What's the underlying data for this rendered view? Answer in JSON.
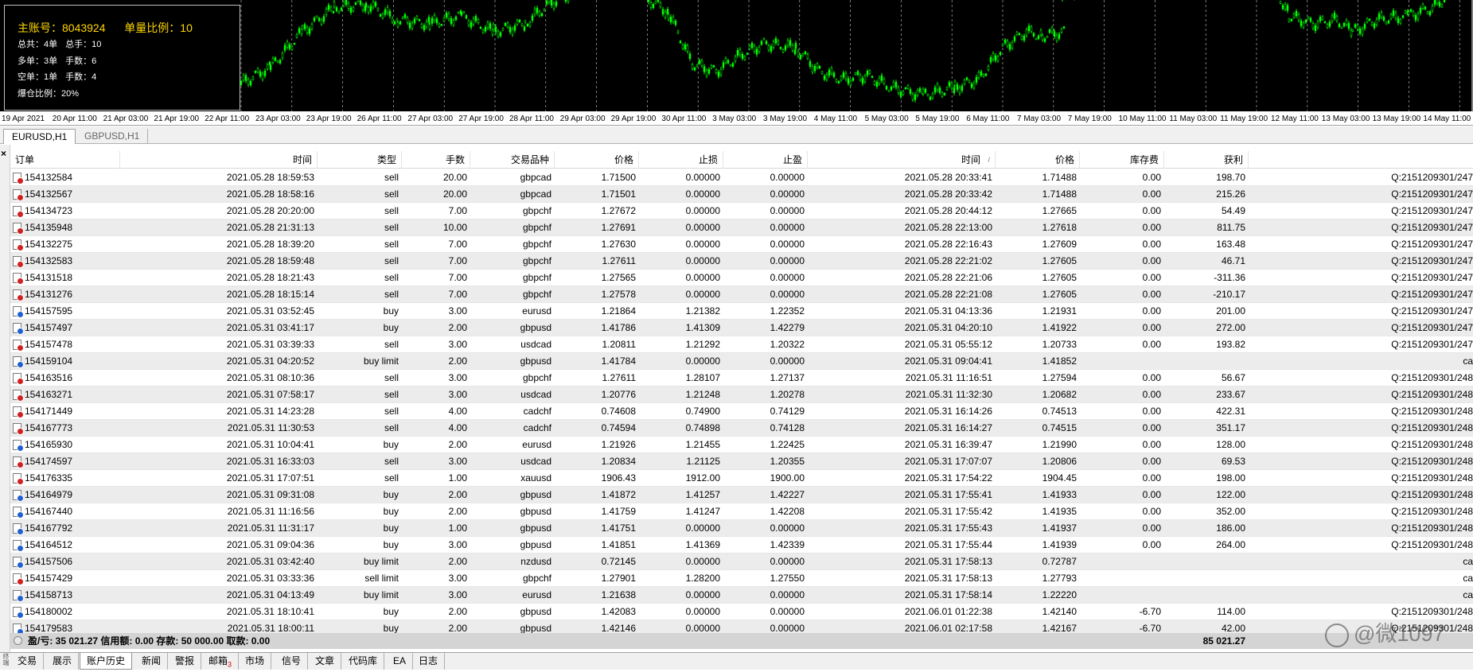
{
  "info_panel": {
    "account_label": "主账号：",
    "account": "8043924",
    "ratio_label": "单量比例：",
    "ratio": "10",
    "total_orders": "总共：4单",
    "total_lots": "总手：10",
    "buy_orders": "多单：3单",
    "buy_lots": "手数：6",
    "sell_orders": "空单：1单",
    "sell_lots": "手数：4",
    "margin_ratio": "爆仓比例：20%"
  },
  "time_axis": [
    "19 Apr 2021",
    "20 Apr 11:00",
    "21 Apr 03:00",
    "21 Apr 19:00",
    "22 Apr 11:00",
    "23 Apr 03:00",
    "23 Apr 19:00",
    "26 Apr 11:00",
    "27 Apr 03:00",
    "27 Apr 19:00",
    "28 Apr 11:00",
    "29 Apr 03:00",
    "29 Apr 19:00",
    "30 Apr 11:00",
    "3 May 03:00",
    "3 May 19:00",
    "4 May 11:00",
    "5 May 03:00",
    "5 May 19:00",
    "6 May 11:00",
    "7 May 03:00",
    "7 May 19:00",
    "10 May 11:00",
    "11 May 03:00",
    "11 May 19:00",
    "12 May 11:00",
    "13 May 03:00",
    "13 May 19:00",
    "14 May 11:00"
  ],
  "chart_tabs": [
    "EURUSD,H1",
    "GBPUSD,H1"
  ],
  "columns": {
    "order": "订单",
    "open_time": "时间",
    "type": "类型",
    "lots": "手数",
    "symbol": "交易品种",
    "open_price": "价格",
    "sl": "止损",
    "tp": "止盈",
    "close_time": "时间",
    "sort_mark": "/",
    "close_price": "价格",
    "swap": "库存费",
    "profit": "获利"
  },
  "rows": [
    {
      "order": "154132584",
      "open_time": "2021.05.28 18:59:53",
      "type": "sell",
      "lots": "20.00",
      "symbol": "gbpcad",
      "open_price": "1.71500",
      "sl": "0.00000",
      "tp": "0.00000",
      "close_time": "2021.05.28 20:33:41",
      "close_price": "1.71488",
      "swap": "0.00",
      "profit": "198.70",
      "comment": "Q:2151209301/247"
    },
    {
      "order": "154132567",
      "open_time": "2021.05.28 18:58:16",
      "type": "sell",
      "lots": "20.00",
      "symbol": "gbpcad",
      "open_price": "1.71501",
      "sl": "0.00000",
      "tp": "0.00000",
      "close_time": "2021.05.28 20:33:42",
      "close_price": "1.71488",
      "swap": "0.00",
      "profit": "215.26",
      "comment": "Q:2151209301/247"
    },
    {
      "order": "154134723",
      "open_time": "2021.05.28 20:20:00",
      "type": "sell",
      "lots": "7.00",
      "symbol": "gbpchf",
      "open_price": "1.27672",
      "sl": "0.00000",
      "tp": "0.00000",
      "close_time": "2021.05.28 20:44:12",
      "close_price": "1.27665",
      "swap": "0.00",
      "profit": "54.49",
      "comment": "Q:2151209301/247"
    },
    {
      "order": "154135948",
      "open_time": "2021.05.28 21:31:13",
      "type": "sell",
      "lots": "10.00",
      "symbol": "gbpchf",
      "open_price": "1.27691",
      "sl": "0.00000",
      "tp": "0.00000",
      "close_time": "2021.05.28 22:13:00",
      "close_price": "1.27618",
      "swap": "0.00",
      "profit": "811.75",
      "comment": "Q:2151209301/247"
    },
    {
      "order": "154132275",
      "open_time": "2021.05.28 18:39:20",
      "type": "sell",
      "lots": "7.00",
      "symbol": "gbpchf",
      "open_price": "1.27630",
      "sl": "0.00000",
      "tp": "0.00000",
      "close_time": "2021.05.28 22:16:43",
      "close_price": "1.27609",
      "swap": "0.00",
      "profit": "163.48",
      "comment": "Q:2151209301/247"
    },
    {
      "order": "154132583",
      "open_time": "2021.05.28 18:59:48",
      "type": "sell",
      "lots": "7.00",
      "symbol": "gbpchf",
      "open_price": "1.27611",
      "sl": "0.00000",
      "tp": "0.00000",
      "close_time": "2021.05.28 22:21:02",
      "close_price": "1.27605",
      "swap": "0.00",
      "profit": "46.71",
      "comment": "Q:2151209301/247"
    },
    {
      "order": "154131518",
      "open_time": "2021.05.28 18:21:43",
      "type": "sell",
      "lots": "7.00",
      "symbol": "gbpchf",
      "open_price": "1.27565",
      "sl": "0.00000",
      "tp": "0.00000",
      "close_time": "2021.05.28 22:21:06",
      "close_price": "1.27605",
      "swap": "0.00",
      "profit": "-311.36",
      "comment": "Q:2151209301/247"
    },
    {
      "order": "154131276",
      "open_time": "2021.05.28 18:15:14",
      "type": "sell",
      "lots": "7.00",
      "symbol": "gbpchf",
      "open_price": "1.27578",
      "sl": "0.00000",
      "tp": "0.00000",
      "close_time": "2021.05.28 22:21:08",
      "close_price": "1.27605",
      "swap": "0.00",
      "profit": "-210.17",
      "comment": "Q:2151209301/247"
    },
    {
      "order": "154157595",
      "open_time": "2021.05.31 03:52:45",
      "type": "buy",
      "lots": "3.00",
      "symbol": "eurusd",
      "open_price": "1.21864",
      "sl": "1.21382",
      "tp": "1.22352",
      "close_time": "2021.05.31 04:13:36",
      "close_price": "1.21931",
      "swap": "0.00",
      "profit": "201.00",
      "comment": "Q:2151209301/247"
    },
    {
      "order": "154157497",
      "open_time": "2021.05.31 03:41:17",
      "type": "buy",
      "lots": "2.00",
      "symbol": "gbpusd",
      "open_price": "1.41786",
      "sl": "1.41309",
      "tp": "1.42279",
      "close_time": "2021.05.31 04:20:10",
      "close_price": "1.41922",
      "swap": "0.00",
      "profit": "272.00",
      "comment": "Q:2151209301/247"
    },
    {
      "order": "154157478",
      "open_time": "2021.05.31 03:39:33",
      "type": "sell",
      "lots": "3.00",
      "symbol": "usdcad",
      "open_price": "1.20811",
      "sl": "1.21292",
      "tp": "1.20322",
      "close_time": "2021.05.31 05:55:12",
      "close_price": "1.20733",
      "swap": "0.00",
      "profit": "193.82",
      "comment": "Q:2151209301/247"
    },
    {
      "order": "154159104",
      "open_time": "2021.05.31 04:20:52",
      "type": "buy limit",
      "lots": "2.00",
      "symbol": "gbpusd",
      "open_price": "1.41784",
      "sl": "0.00000",
      "tp": "0.00000",
      "close_time": "2021.05.31 09:04:41",
      "close_price": "1.41852",
      "swap": "",
      "profit": "",
      "comment": "ca"
    },
    {
      "order": "154163516",
      "open_time": "2021.05.31 08:10:36",
      "type": "sell",
      "lots": "3.00",
      "symbol": "gbpchf",
      "open_price": "1.27611",
      "sl": "1.28107",
      "tp": "1.27137",
      "close_time": "2021.05.31 11:16:51",
      "close_price": "1.27594",
      "swap": "0.00",
      "profit": "56.67",
      "comment": "Q:2151209301/248"
    },
    {
      "order": "154163271",
      "open_time": "2021.05.31 07:58:17",
      "type": "sell",
      "lots": "3.00",
      "symbol": "usdcad",
      "open_price": "1.20776",
      "sl": "1.21248",
      "tp": "1.20278",
      "close_time": "2021.05.31 11:32:30",
      "close_price": "1.20682",
      "swap": "0.00",
      "profit": "233.67",
      "comment": "Q:2151209301/248"
    },
    {
      "order": "154171449",
      "open_time": "2021.05.31 14:23:28",
      "type": "sell",
      "lots": "4.00",
      "symbol": "cadchf",
      "open_price": "0.74608",
      "sl": "0.74900",
      "tp": "0.74129",
      "close_time": "2021.05.31 16:14:26",
      "close_price": "0.74513",
      "swap": "0.00",
      "profit": "422.31",
      "comment": "Q:2151209301/248"
    },
    {
      "order": "154167773",
      "open_time": "2021.05.31 11:30:53",
      "type": "sell",
      "lots": "4.00",
      "symbol": "cadchf",
      "open_price": "0.74594",
      "sl": "0.74898",
      "tp": "0.74128",
      "close_time": "2021.05.31 16:14:27",
      "close_price": "0.74515",
      "swap": "0.00",
      "profit": "351.17",
      "comment": "Q:2151209301/248"
    },
    {
      "order": "154165930",
      "open_time": "2021.05.31 10:04:41",
      "type": "buy",
      "lots": "2.00",
      "symbol": "eurusd",
      "open_price": "1.21926",
      "sl": "1.21455",
      "tp": "1.22425",
      "close_time": "2021.05.31 16:39:47",
      "close_price": "1.21990",
      "swap": "0.00",
      "profit": "128.00",
      "comment": "Q:2151209301/248"
    },
    {
      "order": "154174597",
      "open_time": "2021.05.31 16:33:03",
      "type": "sell",
      "lots": "3.00",
      "symbol": "usdcad",
      "open_price": "1.20834",
      "sl": "1.21125",
      "tp": "1.20355",
      "close_time": "2021.05.31 17:07:07",
      "close_price": "1.20806",
      "swap": "0.00",
      "profit": "69.53",
      "comment": "Q:2151209301/248"
    },
    {
      "order": "154176335",
      "open_time": "2021.05.31 17:07:51",
      "type": "sell",
      "lots": "1.00",
      "symbol": "xauusd",
      "open_price": "1906.43",
      "sl": "1912.00",
      "tp": "1900.00",
      "close_time": "2021.05.31 17:54:22",
      "close_price": "1904.45",
      "swap": "0.00",
      "profit": "198.00",
      "comment": "Q:2151209301/248"
    },
    {
      "order": "154164979",
      "open_time": "2021.05.31 09:31:08",
      "type": "buy",
      "lots": "2.00",
      "symbol": "gbpusd",
      "open_price": "1.41872",
      "sl": "1.41257",
      "tp": "1.42227",
      "close_time": "2021.05.31 17:55:41",
      "close_price": "1.41933",
      "swap": "0.00",
      "profit": "122.00",
      "comment": "Q:2151209301/248"
    },
    {
      "order": "154167440",
      "open_time": "2021.05.31 11:16:56",
      "type": "buy",
      "lots": "2.00",
      "symbol": "gbpusd",
      "open_price": "1.41759",
      "sl": "1.41247",
      "tp": "1.42208",
      "close_time": "2021.05.31 17:55:42",
      "close_price": "1.41935",
      "swap": "0.00",
      "profit": "352.00",
      "comment": "Q:2151209301/248"
    },
    {
      "order": "154167792",
      "open_time": "2021.05.31 11:31:17",
      "type": "buy",
      "lots": "1.00",
      "symbol": "gbpusd",
      "open_price": "1.41751",
      "sl": "0.00000",
      "tp": "0.00000",
      "close_time": "2021.05.31 17:55:43",
      "close_price": "1.41937",
      "swap": "0.00",
      "profit": "186.00",
      "comment": "Q:2151209301/248"
    },
    {
      "order": "154164512",
      "open_time": "2021.05.31 09:04:36",
      "type": "buy",
      "lots": "3.00",
      "symbol": "gbpusd",
      "open_price": "1.41851",
      "sl": "1.41369",
      "tp": "1.42339",
      "close_time": "2021.05.31 17:55:44",
      "close_price": "1.41939",
      "swap": "0.00",
      "profit": "264.00",
      "comment": "Q:2151209301/248"
    },
    {
      "order": "154157506",
      "open_time": "2021.05.31 03:42:40",
      "type": "buy limit",
      "lots": "2.00",
      "symbol": "nzdusd",
      "open_price": "0.72145",
      "sl": "0.00000",
      "tp": "0.00000",
      "close_time": "2021.05.31 17:58:13",
      "close_price": "0.72787",
      "swap": "",
      "profit": "",
      "comment": "ca"
    },
    {
      "order": "154157429",
      "open_time": "2021.05.31 03:33:36",
      "type": "sell limit",
      "lots": "3.00",
      "symbol": "gbpchf",
      "open_price": "1.27901",
      "sl": "1.28200",
      "tp": "1.27550",
      "close_time": "2021.05.31 17:58:13",
      "close_price": "1.27793",
      "swap": "",
      "profit": "",
      "comment": "ca"
    },
    {
      "order": "154158713",
      "open_time": "2021.05.31 04:13:49",
      "type": "buy limit",
      "lots": "3.00",
      "symbol": "eurusd",
      "open_price": "1.21638",
      "sl": "0.00000",
      "tp": "0.00000",
      "close_time": "2021.05.31 17:58:14",
      "close_price": "1.22220",
      "swap": "",
      "profit": "",
      "comment": "ca"
    },
    {
      "order": "154180002",
      "open_time": "2021.05.31 18:10:41",
      "type": "buy",
      "lots": "2.00",
      "symbol": "gbpusd",
      "open_price": "1.42083",
      "sl": "0.00000",
      "tp": "0.00000",
      "close_time": "2021.06.01 01:22:38",
      "close_price": "1.42140",
      "swap": "-6.70",
      "profit": "114.00",
      "comment": "Q:2151209301/248"
    },
    {
      "order": "154179583",
      "open_time": "2021.05.31 18:00:11",
      "type": "buy",
      "lots": "2.00",
      "symbol": "gbpusd",
      "open_price": "1.42146",
      "sl": "0.00000",
      "tp": "0.00000",
      "close_time": "2021.06.01 02:17:58",
      "close_price": "1.42167",
      "swap": "-6.70",
      "profit": "42.00",
      "comment": "Q:2151209301/248"
    }
  ],
  "summary": {
    "text": "盈/亏: 35 021.27  信用额: 0.00  存款: 50 000.00  取款: 0.00",
    "total_profit": "85 021.27"
  },
  "bottom_tabs": [
    {
      "label": "交易",
      "active": false,
      "badge": ""
    },
    {
      "label": "展示",
      "active": false,
      "badge": ""
    },
    {
      "label": "账户历史",
      "active": true,
      "badge": ""
    },
    {
      "label": "新闻",
      "active": false,
      "badge": ""
    },
    {
      "label": "警报",
      "active": false,
      "badge": ""
    },
    {
      "label": "邮箱",
      "active": false,
      "badge": "3"
    },
    {
      "label": "市场",
      "active": false,
      "badge": ""
    },
    {
      "label": "信号",
      "active": false,
      "badge": ""
    },
    {
      "label": "文章",
      "active": false,
      "badge": ""
    },
    {
      "label": "代码库",
      "active": false,
      "badge": ""
    },
    {
      "label": "EA",
      "active": false,
      "badge": ""
    },
    {
      "label": "日志",
      "active": false,
      "badge": ""
    }
  ],
  "terminal_label": "终端",
  "watermark": "@微1097",
  "colors": {
    "chart_bg": "#000000",
    "candles": "#00ff00",
    "grid": "#c8c8c8",
    "sell_icon_dot": "#d02020",
    "buy_icon_dot": "#2060d0"
  }
}
